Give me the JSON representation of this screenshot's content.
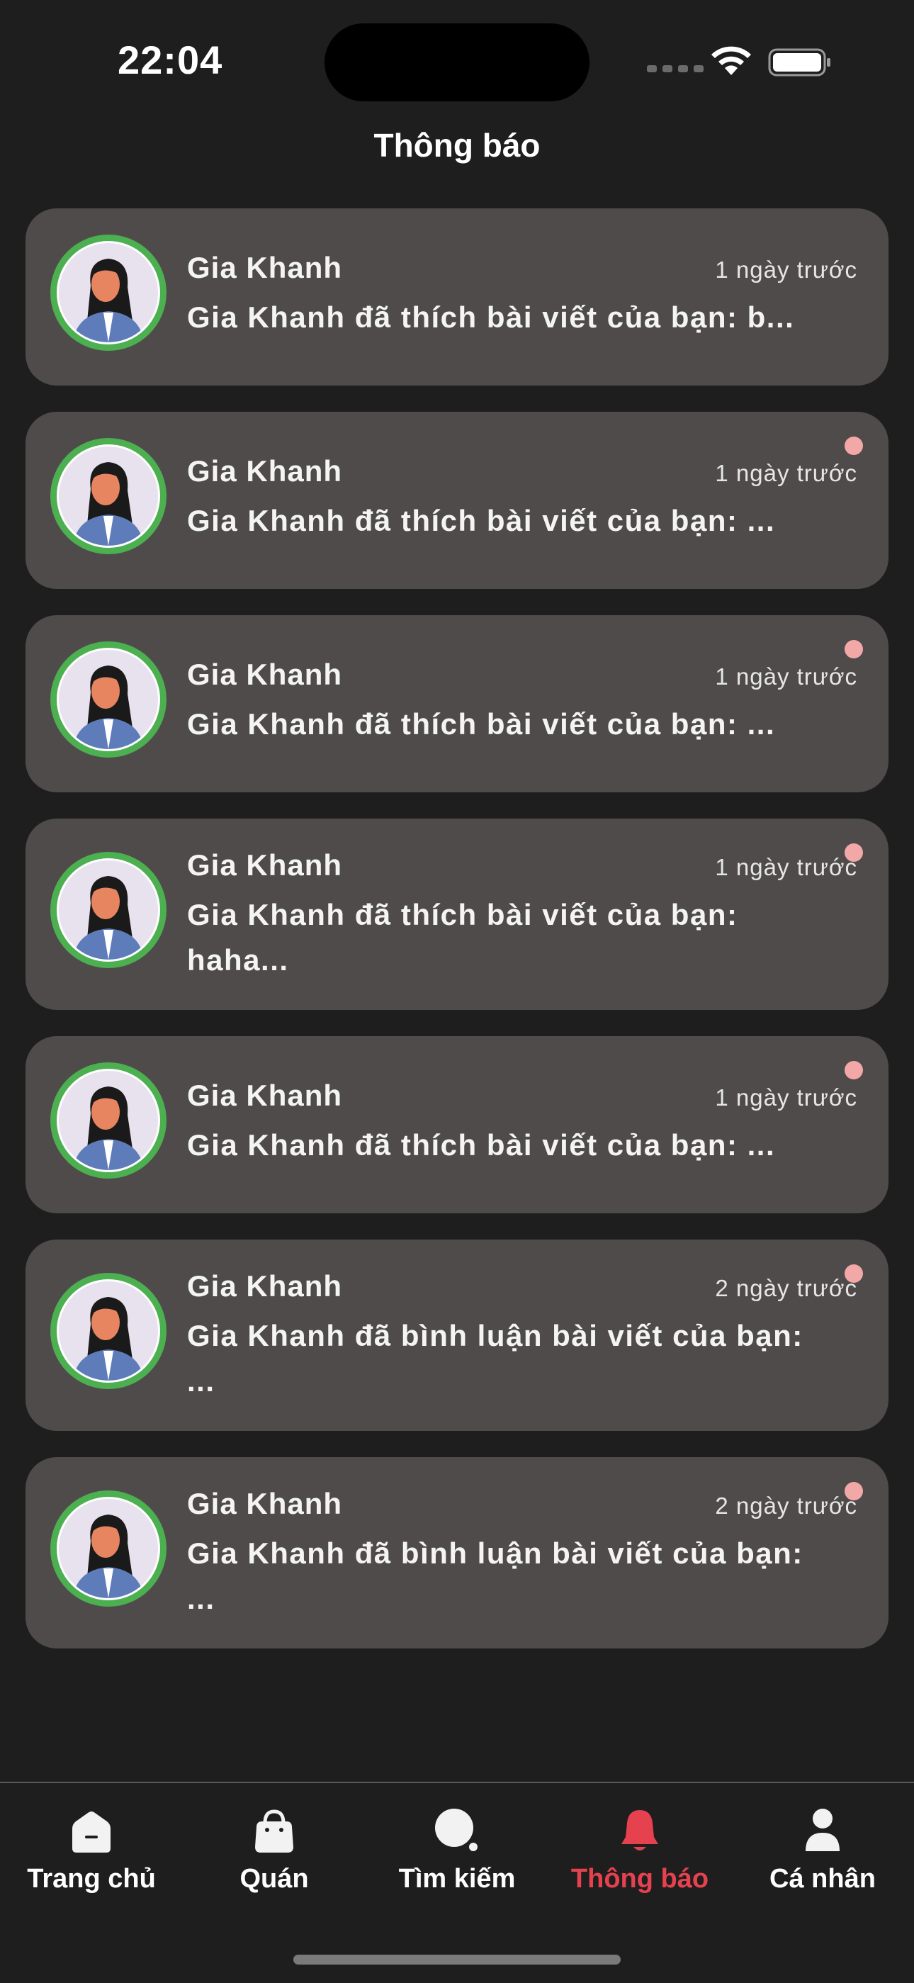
{
  "status_bar": {
    "time": "22:04"
  },
  "header": {
    "title": "Thông báo"
  },
  "notifications": [
    {
      "sender": "Gia Khanh",
      "time": "1 ngày trước",
      "message": "Gia Khanh đã thích bài viết của bạn: b...",
      "unread": false
    },
    {
      "sender": "Gia Khanh",
      "time": "1 ngày trước",
      "message": "Gia Khanh đã thích bài viết của bạn: ...",
      "unread": true
    },
    {
      "sender": "Gia Khanh",
      "time": "1 ngày trước",
      "message": "Gia Khanh đã thích bài viết của bạn: ...",
      "unread": true
    },
    {
      "sender": "Gia Khanh",
      "time": "1 ngày trước",
      "message": "Gia Khanh đã thích bài viết của bạn: haha...",
      "unread": true
    },
    {
      "sender": "Gia Khanh",
      "time": "1 ngày trước",
      "message": "Gia Khanh đã thích bài viết của bạn: ...",
      "unread": true
    },
    {
      "sender": "Gia Khanh",
      "time": "2 ngày trước",
      "message": "Gia Khanh đã bình luận bài viết của bạn: ...",
      "unread": true
    },
    {
      "sender": "Gia Khanh",
      "time": "2 ngày trước",
      "message": "Gia Khanh đã bình luận bài viết của bạn: ...",
      "unread": true
    }
  ],
  "bottom_nav": {
    "items": [
      {
        "label": "Trang chủ",
        "icon": "home-icon",
        "active": false
      },
      {
        "label": "Quán",
        "icon": "shopping-bag-icon",
        "active": false
      },
      {
        "label": "Tìm kiếm",
        "icon": "search-icon",
        "active": false
      },
      {
        "label": "Thông báo",
        "icon": "bell-icon",
        "active": true
      },
      {
        "label": "Cá nhân",
        "icon": "person-icon",
        "active": false
      }
    ]
  },
  "colors": {
    "background": "#1e1e1e",
    "card": "#4f4b4b",
    "avatar_ring": "#4caf50",
    "unread_dot": "#f3a8a8",
    "active_tab": "#e5414f"
  }
}
